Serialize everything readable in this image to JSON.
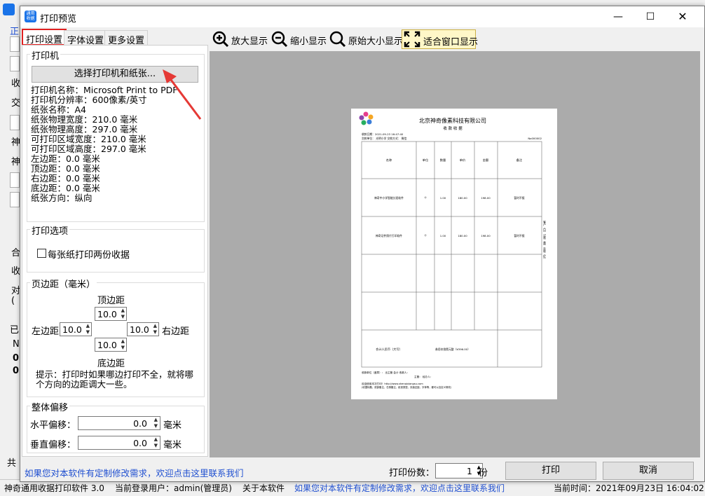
{
  "background_app": {
    "left_chars": [
      "正",
      "收",
      "交",
      "神",
      "神",
      "合",
      "收",
      "对",
      "(",
      "已",
      "N",
      "0",
      "0",
      "共"
    ],
    "status": {
      "app_name": "神奇通用收据打印软件 3.0",
      "user": "当前登录用户：admin(管理员)",
      "about": "关于本软件",
      "link": "如果您对本软件有定制修改需求，欢迎点击这里联系我们",
      "time": "当前时间：2021年09月23日 16:04:02"
    }
  },
  "dialog": {
    "title": "打印预览",
    "app_icon_text": "通用收据",
    "controls": {
      "minimize": "—",
      "maximize": "☐",
      "close": "✕"
    }
  },
  "tabs": [
    {
      "label": "打印设置",
      "active": true
    },
    {
      "label": "字体设置",
      "active": false
    },
    {
      "label": "更多设置",
      "active": false
    }
  ],
  "printer_group": {
    "title": "打印机",
    "select_button": "选择打印机和纸张...",
    "info": [
      "打印机名称：Microsoft Print to PDF",
      "打印机分辨率：600像素/英寸",
      "纸张名称：A4",
      "纸张物理宽度：210.0 毫米",
      "纸张物理高度：297.0 毫米",
      "可打印区域宽度：210.0 毫米",
      "可打印区域高度：297.0 毫米",
      "左边距：0.0 毫米",
      "顶边距：0.0 毫米",
      "右边距：0.0 毫米",
      "底边距：0.0 毫米",
      "纸张方向：纵向"
    ]
  },
  "print_options": {
    "title": "打印选项",
    "two_copies_label": "每张纸打印两份收据",
    "two_copies_checked": false
  },
  "margins": {
    "title": "页边距（毫米）",
    "top_label": "顶边距",
    "top_value": "10.0",
    "left_label": "左边距",
    "left_value": "10.0",
    "right_label": "右边距",
    "right_value": "10.0",
    "bottom_label": "底边距",
    "bottom_value": "10.0",
    "hint": "提示：打印时如果哪边打印不全，就将哪个方向的边距调大一些。"
  },
  "offset": {
    "title": "整体偏移",
    "horizontal_label": "水平偏移：",
    "horizontal_value": "0.0",
    "vertical_label": "垂直偏移：",
    "vertical_value": "0.0",
    "unit": "毫米"
  },
  "toolbar": {
    "zoom_in": "放大显示",
    "zoom_out": "缩小显示",
    "original_size": "原始大小显示",
    "fit_window": "适合窗口显示"
  },
  "receipt": {
    "company": "北京神奇像素科技有限公司",
    "doc_title": "收 款 收 据",
    "meta_left": "收款日期：2021-09-23 16:47:40",
    "meta_left2": "交款单位：  光明小学     交款方式：  微信",
    "number": "No000002",
    "headers": [
      "名称",
      "单位",
      "数量",
      "单价",
      "金额",
      "备注"
    ],
    "rows": [
      [
        "神奇中小学智能分班软件",
        "个",
        "1.00",
        "180.00",
        "198.00",
        "暂时不报"
      ],
      [
        "神奇证件照片打印软件",
        "个",
        "1.00",
        "180.00",
        "198.00",
        "暂时不报"
      ],
      [
        "",
        "",
        "",
        "",
        "",
        ""
      ],
      [
        "",
        "",
        "",
        "",
        "",
        ""
      ]
    ],
    "total_label": "合计人民币（大写）",
    "total_value": "叁佰玖拾捌元整（¥396.00）",
    "side_note": "客户（白）记账（黄）存根（红）",
    "sign_line1": "收款单位（盖章）：         出主管         会计         收款人：",
    "sign_line2": "主管：                  经办人：",
    "footer1": "欢迎使用本次打印！http://www.shenqixiangsu.com",
    "footer2": "(收据标题、底部备注、右侧备注、纸张类型、页面边距、字体等，都可以自定义修改)"
  },
  "bottom": {
    "link": "如果您对本软件有定制修改需求，欢迎点击这里联系我们",
    "copies_label": "打印份数：",
    "copies_value": "1",
    "copies_unit": "份",
    "print_button": "打印",
    "cancel_button": "取消"
  },
  "colors": {
    "accent_red": "#e02020",
    "link_blue": "#1f4fd0",
    "preview_gray": "#ababab",
    "app_icon_blue": "#1a73e8"
  }
}
